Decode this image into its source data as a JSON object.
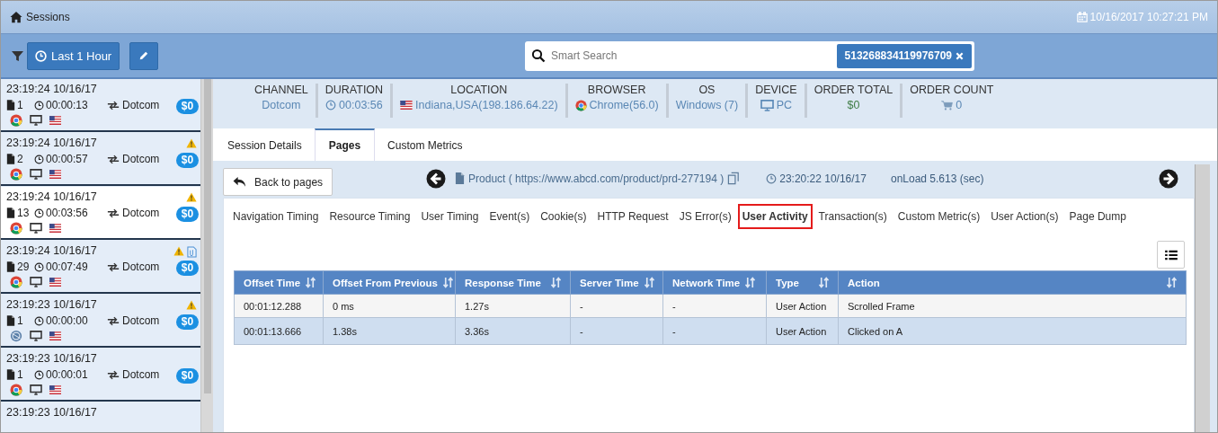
{
  "header": {
    "title": "Sessions",
    "datetime": "10/16/2017 10:27:21 PM"
  },
  "toolbar": {
    "time_range": "Last 1 Hour",
    "search_placeholder": "Smart Search",
    "search_chip": "513268834119976709"
  },
  "sessions": [
    {
      "time": "23:19:24 10/16/17",
      "pages": "1",
      "duration": "00:00:13",
      "channel": "Dotcom",
      "amount": "$0",
      "kind": "chrome",
      "warning": false,
      "attachment": false,
      "selected": false
    },
    {
      "time": "23:19:24 10/16/17",
      "pages": "2",
      "duration": "00:00:57",
      "channel": "Dotcom",
      "amount": "$0",
      "kind": "chrome",
      "warning": true,
      "attachment": false,
      "selected": false
    },
    {
      "time": "23:19:24 10/16/17",
      "pages": "13",
      "duration": "00:03:56",
      "channel": "Dotcom",
      "amount": "$0",
      "kind": "chrome",
      "warning": true,
      "attachment": false,
      "selected": true
    },
    {
      "time": "23:19:24 10/16/17",
      "pages": "29",
      "duration": "00:07:49",
      "channel": "Dotcom",
      "amount": "$0",
      "kind": "chrome",
      "warning": true,
      "attachment": true,
      "selected": false
    },
    {
      "time": "23:19:23 10/16/17",
      "pages": "1",
      "duration": "00:00:00",
      "channel": "Dotcom",
      "amount": "$0",
      "kind": "other",
      "warning": true,
      "attachment": false,
      "selected": false
    },
    {
      "time": "23:19:23 10/16/17",
      "pages": "1",
      "duration": "00:00:01",
      "channel": "Dotcom",
      "amount": "$0",
      "kind": "chrome",
      "warning": false,
      "attachment": false,
      "selected": false
    },
    {
      "time": "23:19:23 10/16/17",
      "selected": false
    }
  ],
  "metrics": [
    {
      "kind": "plain",
      "label": "CHANNEL",
      "value": "Dotcom"
    },
    {
      "kind": "duration",
      "label": "DURATION",
      "value": "00:03:56"
    },
    {
      "kind": "location",
      "label": "LOCATION",
      "value": "Indiana,USA(198.186.64.22)"
    },
    {
      "kind": "browser",
      "label": "BROWSER",
      "value": "Chrome(56.0)"
    },
    {
      "kind": "plain",
      "label": "OS",
      "value": "Windows (7)"
    },
    {
      "kind": "device",
      "label": "DEVICE",
      "value": "PC"
    },
    {
      "kind": "money",
      "label": "ORDER TOTAL",
      "value": "$0"
    },
    {
      "kind": "count",
      "label": "ORDER COUNT",
      "value": "0"
    }
  ],
  "tabs": [
    {
      "label": "Session Details",
      "selected": false
    },
    {
      "label": "Pages",
      "selected": true
    },
    {
      "label": "Custom Metrics",
      "selected": false
    }
  ],
  "page_nav": {
    "back": "Back to pages",
    "page": "Product ( https://www.abcd.com/product/prd-277194 )",
    "time": "23:20:22 10/16/17",
    "onload": "onLoad 5.613 (sec)"
  },
  "sub_tabs": [
    {
      "label": "Navigation Timing",
      "selected": false
    },
    {
      "label": "Resource Timing",
      "selected": false
    },
    {
      "label": "User Timing",
      "selected": false
    },
    {
      "label": "Event(s)",
      "selected": false
    },
    {
      "label": "Cookie(s)",
      "selected": false
    },
    {
      "label": "HTTP Request",
      "selected": false
    },
    {
      "label": "JS Error(s)",
      "selected": false
    },
    {
      "label": "User Activity",
      "selected": true
    },
    {
      "label": "Transaction(s)",
      "selected": false
    },
    {
      "label": "Custom Metric(s)",
      "selected": false
    },
    {
      "label": "User Action(s)",
      "selected": false
    },
    {
      "label": "Page Dump",
      "selected": false
    }
  ],
  "table": {
    "columns": [
      "Offset Time",
      "Offset From Previous",
      "Response Time",
      "Server Time",
      "Network Time",
      "Type",
      "Action"
    ],
    "rows": [
      {
        "cells": [
          "00:01:12.288",
          "0 ms",
          "1.27s",
          "-",
          "-",
          "User Action",
          "Scrolled Frame"
        ],
        "selected": false
      },
      {
        "cells": [
          "00:01:13.666",
          "1.38s",
          "3.36s",
          "-",
          "-",
          "User Action",
          "Clicked on A"
        ],
        "selected": true
      }
    ]
  }
}
